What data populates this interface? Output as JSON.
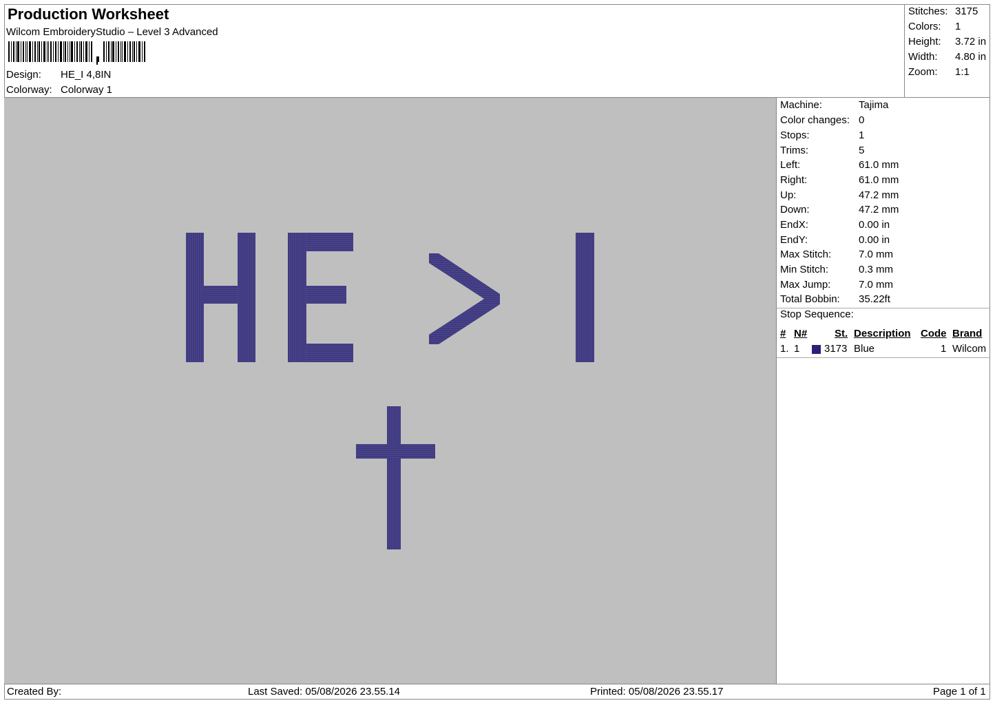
{
  "header": {
    "title": "Production Worksheet",
    "subtitle": "Wilcom EmbroideryStudio – Level 3 Advanced",
    "design_label": "Design:",
    "design_value": "HE_I 4,8IN",
    "colorway_label": "Colorway:",
    "colorway_value": "Colorway 1"
  },
  "stats": [
    {
      "label": "Stitches:",
      "value": "3175"
    },
    {
      "label": "Colors:",
      "value": "1"
    },
    {
      "label": "Height:",
      "value": "3.72 in"
    },
    {
      "label": "Width:",
      "value": "4.80 in"
    },
    {
      "label": "Zoom:",
      "value": "1:1"
    }
  ],
  "machine": [
    {
      "label": "Machine:",
      "value": "Tajima"
    },
    {
      "label": "Color changes:",
      "value": "0"
    },
    {
      "label": "Stops:",
      "value": "1"
    },
    {
      "label": "Trims:",
      "value": "5"
    },
    {
      "label": "Left:",
      "value": "61.0 mm"
    },
    {
      "label": "Right:",
      "value": "61.0 mm"
    },
    {
      "label": "Up:",
      "value": "47.2 mm"
    },
    {
      "label": "Down:",
      "value": "47.2 mm"
    },
    {
      "label": "EndX:",
      "value": "0.00 in"
    },
    {
      "label": "EndY:",
      "value": "0.00 in"
    },
    {
      "label": "Max Stitch:",
      "value": "7.0 mm"
    },
    {
      "label": "Min Stitch:",
      "value": "0.3 mm"
    },
    {
      "label": "Max Jump:",
      "value": "7.0 mm"
    },
    {
      "label": "Total Bobbin:",
      "value": "35.22ft"
    }
  ],
  "stop_sequence": {
    "title": "Stop Sequence:",
    "columns": [
      "#",
      "N#",
      "St.",
      "Description",
      "Code",
      "Brand"
    ],
    "rows": [
      {
        "num": "1.",
        "n": "1",
        "color": "#2a2277",
        "st": "3173",
        "description": "Blue",
        "code": "1",
        "brand": "Wilcom"
      }
    ]
  },
  "design_colors": {
    "thread": "#3f3a7e",
    "background": "#bfbfbf"
  },
  "footer": {
    "created_by": "Created By:",
    "last_saved": "Last Saved: 05/08/2026 23.55.14",
    "printed": "Printed: 05/08/2026 23.55.17",
    "page": "Page 1 of 1"
  }
}
